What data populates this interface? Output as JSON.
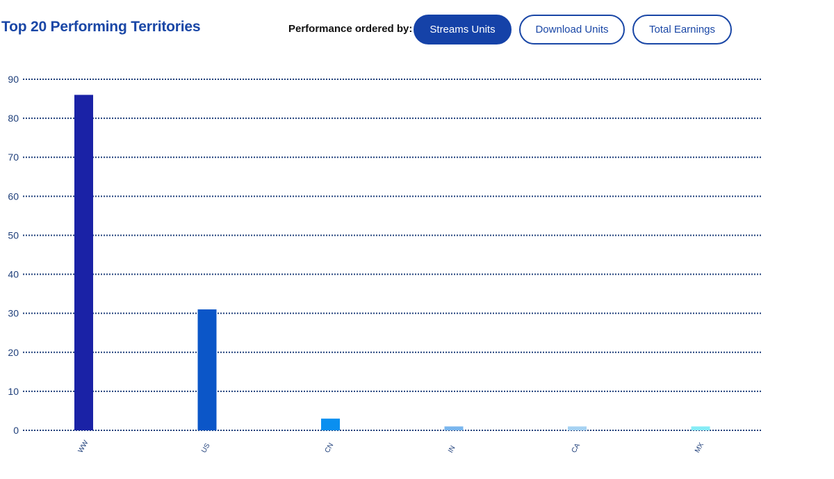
{
  "header": {
    "title": "Top 20 Performing Territories",
    "order_label": "Performance ordered by:",
    "buttons": [
      {
        "label": "Streams Units",
        "active": true
      },
      {
        "label": "Download Units",
        "active": false
      },
      {
        "label": "Total Earnings",
        "active": false
      }
    ]
  },
  "colors": {
    "accent": "#1542a8",
    "title": "#1a47a6",
    "grid": "#1f3f7a"
  },
  "chart_data": {
    "type": "bar",
    "categories": [
      "WW",
      "US",
      "CN",
      "IN",
      "CA",
      "MX"
    ],
    "values": [
      86,
      31,
      3,
      1,
      1,
      1
    ],
    "bar_colors": [
      "#1a22a6",
      "#0b56c8",
      "#0a8ff0",
      "#79b6ee",
      "#a6d2f2",
      "#86ecf6"
    ],
    "ylim": [
      0,
      90
    ],
    "yticks": [
      0,
      10,
      20,
      30,
      40,
      50,
      60,
      70,
      80,
      90
    ],
    "grid": true,
    "grid_style": "dotted",
    "title": "",
    "xlabel": "",
    "ylabel": ""
  }
}
